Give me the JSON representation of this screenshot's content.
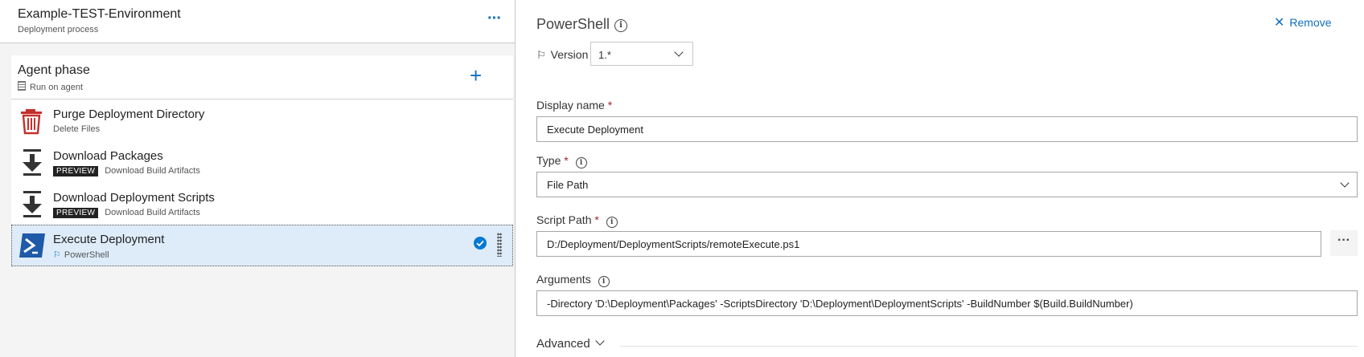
{
  "environment": {
    "title": "Example-TEST-Environment",
    "subtitle": "Deployment process",
    "more": "···"
  },
  "phase": {
    "title": "Agent phase",
    "subtitle": "Run on agent",
    "add": "+"
  },
  "tasks": [
    {
      "name": "Purge Deployment Directory",
      "subtitle": "Delete Files",
      "badge": "",
      "icon": "trash-icon"
    },
    {
      "name": "Download Packages",
      "subtitle": "Download Build Artifacts",
      "badge": "PREVIEW",
      "icon": "download-icon"
    },
    {
      "name": "Download Deployment Scripts",
      "subtitle": "Download Build Artifacts",
      "badge": "PREVIEW",
      "icon": "download-icon"
    },
    {
      "name": "Execute Deployment",
      "subtitle": "PowerShell",
      "badge": "",
      "icon": "powershell-icon",
      "selected": true
    }
  ],
  "details": {
    "title": "PowerShell",
    "remove_label": "Remove",
    "version_label": "Version",
    "version_value": "1.*",
    "display_name_label": "Display name",
    "display_name_value": "Execute Deployment",
    "type_label": "Type",
    "type_value": "File Path",
    "script_path_label": "Script Path",
    "script_path_value": "D:/Deployment/DeploymentScripts/remoteExecute.ps1",
    "script_path_button": "···",
    "arguments_label": "Arguments",
    "arguments_value": "-Directory 'D:\\Deployment\\Packages' -ScriptsDirectory 'D:\\Deployment\\DeploymentScripts' -BuildNumber $(Build.BuildNumber)",
    "advanced_label": "Advanced",
    "required_mark": "*"
  },
  "colors": {
    "accent": "#0078d4",
    "link": "#106ebe",
    "selected_bg": "#deecf9",
    "trash_red": "#c4302b",
    "powershell_blue": "#1e5aa8"
  }
}
